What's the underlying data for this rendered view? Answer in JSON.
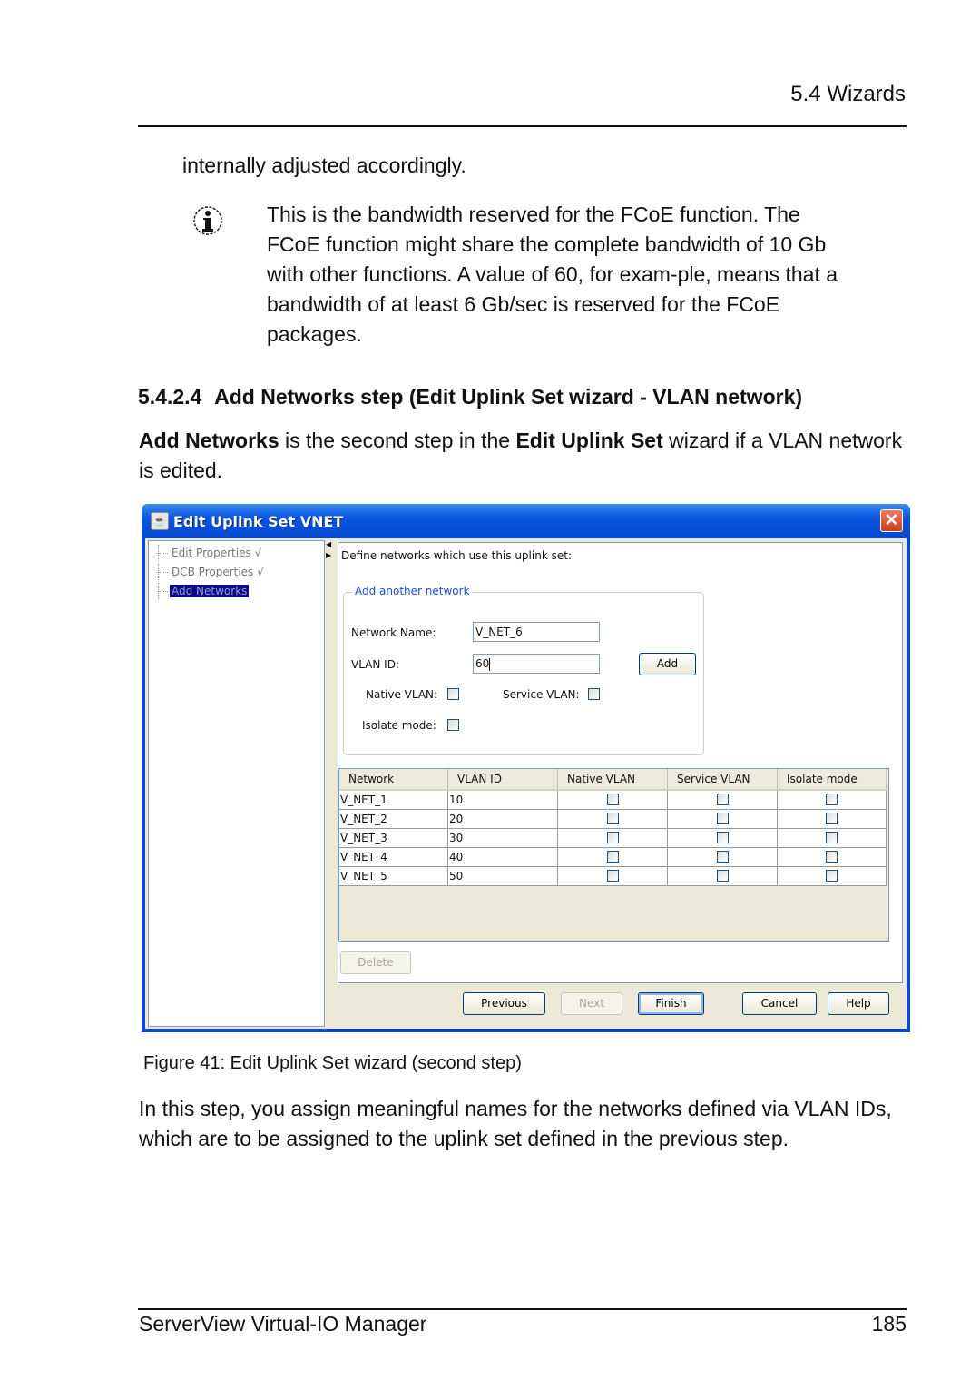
{
  "page": {
    "header_title": "5.4 Wizards",
    "continued_text": "internally adjusted accordingly.",
    "note_text": "This is the bandwidth reserved for the FCoE function. The FCoE function might share the complete bandwidth of 10 Gb with other functions. A value of 60, for exam-ple, means that a bandwidth of at least 6 Gb/sec is reserved for the FCoE packages.",
    "note_icon": "info-icon",
    "section_number": "5.4.2.4",
    "section_title": "Add Networks step (Edit Uplink Set wizard - VLAN network)",
    "intro": {
      "bold1": "Add Networks",
      "text1": " is the second step in the ",
      "bold2": "Edit Uplink Set",
      "text2": " wizard if a VLAN network is edited."
    },
    "figure_caption": "Figure 41: Edit Uplink Set wizard (second step)",
    "outro": "In this step, you assign meaningful names for the networks defined via VLAN IDs, which are to be assigned to the uplink set defined in the previous step.",
    "footer_left": "ServerView Virtual-IO Manager",
    "footer_page": "185"
  },
  "dialog": {
    "title": "Edit Uplink Set VNET",
    "close_label": "✕",
    "tree": [
      {
        "label": "Edit Properties √",
        "selected": false
      },
      {
        "label": "DCB Properties √",
        "selected": false
      },
      {
        "label": "Add Networks",
        "selected": true
      }
    ],
    "define_label": "Define networks which use this uplink set:",
    "group_title": "Add another network",
    "network_name_label": "Network Name:",
    "network_name_value": "V_NET_6",
    "vlan_id_label": "VLAN ID:",
    "vlan_id_value": "60",
    "add_label": "Add",
    "native_vlan_label": "Native VLAN:",
    "service_vlan_label": "Service VLAN:",
    "isolate_mode_label": "Isolate mode:",
    "table": {
      "columns": [
        "Network",
        "VLAN ID",
        "Native VLAN",
        "Service VLAN",
        "Isolate mode"
      ],
      "rows": [
        {
          "network": "V_NET_1",
          "vlan": "10"
        },
        {
          "network": "V_NET_2",
          "vlan": "20"
        },
        {
          "network": "V_NET_3",
          "vlan": "30"
        },
        {
          "network": "V_NET_4",
          "vlan": "40"
        },
        {
          "network": "V_NET_5",
          "vlan": "50"
        }
      ]
    },
    "delete_label": "Delete",
    "buttons": {
      "previous": "Previous",
      "next": "Next",
      "finish": "Finish",
      "cancel": "Cancel",
      "help": "Help"
    }
  }
}
